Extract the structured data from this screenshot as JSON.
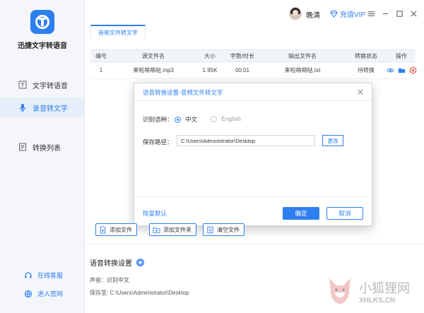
{
  "app": {
    "name": "迅捷文字转语音"
  },
  "sidebar": {
    "items": [
      {
        "label": "文字转语音",
        "icon": "text-icon",
        "active": false
      },
      {
        "label": "录音转文字",
        "icon": "microphone-icon",
        "active": true
      },
      {
        "label": "转换列表",
        "icon": "list-icon",
        "active": false
      }
    ],
    "links": [
      {
        "label": "在线客服",
        "icon": "headset-icon"
      },
      {
        "label": "进入官网",
        "icon": "globe-icon"
      }
    ]
  },
  "header": {
    "username": "晚清",
    "vip_label": "充值VIP",
    "window_controls": [
      "settings-icon",
      "minimize-icon",
      "maximize-icon",
      "close-icon"
    ]
  },
  "tab": {
    "label": "音频文件转文字"
  },
  "table": {
    "columns": [
      "编号",
      "源文件名",
      "大小",
      "字数/时长",
      "输出文件名",
      "转换状态",
      "操作"
    ],
    "rows": [
      {
        "index": "1",
        "source": "来啦萌萌哒.mp3",
        "size": "1.95K",
        "duration": "00:01",
        "output": "来啦萌萌哒.txt",
        "status": "待转换"
      }
    ],
    "row_ops": [
      "eye-icon",
      "folder-icon",
      "delete-icon"
    ]
  },
  "dialog": {
    "title": "语音转换设置-音频文件转文字",
    "language_label": "识别语种：",
    "languages": [
      {
        "label": "中文",
        "selected": true
      },
      {
        "label": "English",
        "selected": false
      }
    ],
    "path_label": "保存路径：",
    "path_value": "C:\\Users\\Administrator\\Desktop",
    "change_label": "更改",
    "restore_label": "恢复默认",
    "ok_label": "确定",
    "cancel_label": "取消"
  },
  "actions": [
    {
      "label": "添加文件",
      "icon": "add-file-icon"
    },
    {
      "label": "添加文件夹",
      "icon": "add-folder-icon"
    },
    {
      "label": "清空文件",
      "icon": "clear-icon"
    }
  ],
  "settings": {
    "title": "语音转换设置",
    "voice_line": "声音：识别中文",
    "save_line": "保存至: C:\\Users\\Administrator\\Desktop"
  },
  "watermark": {
    "line1": "小狐狸网",
    "line2": "XHLKS.CN"
  },
  "colors": {
    "accent": "#2e7ff0",
    "danger": "#e0403a"
  }
}
